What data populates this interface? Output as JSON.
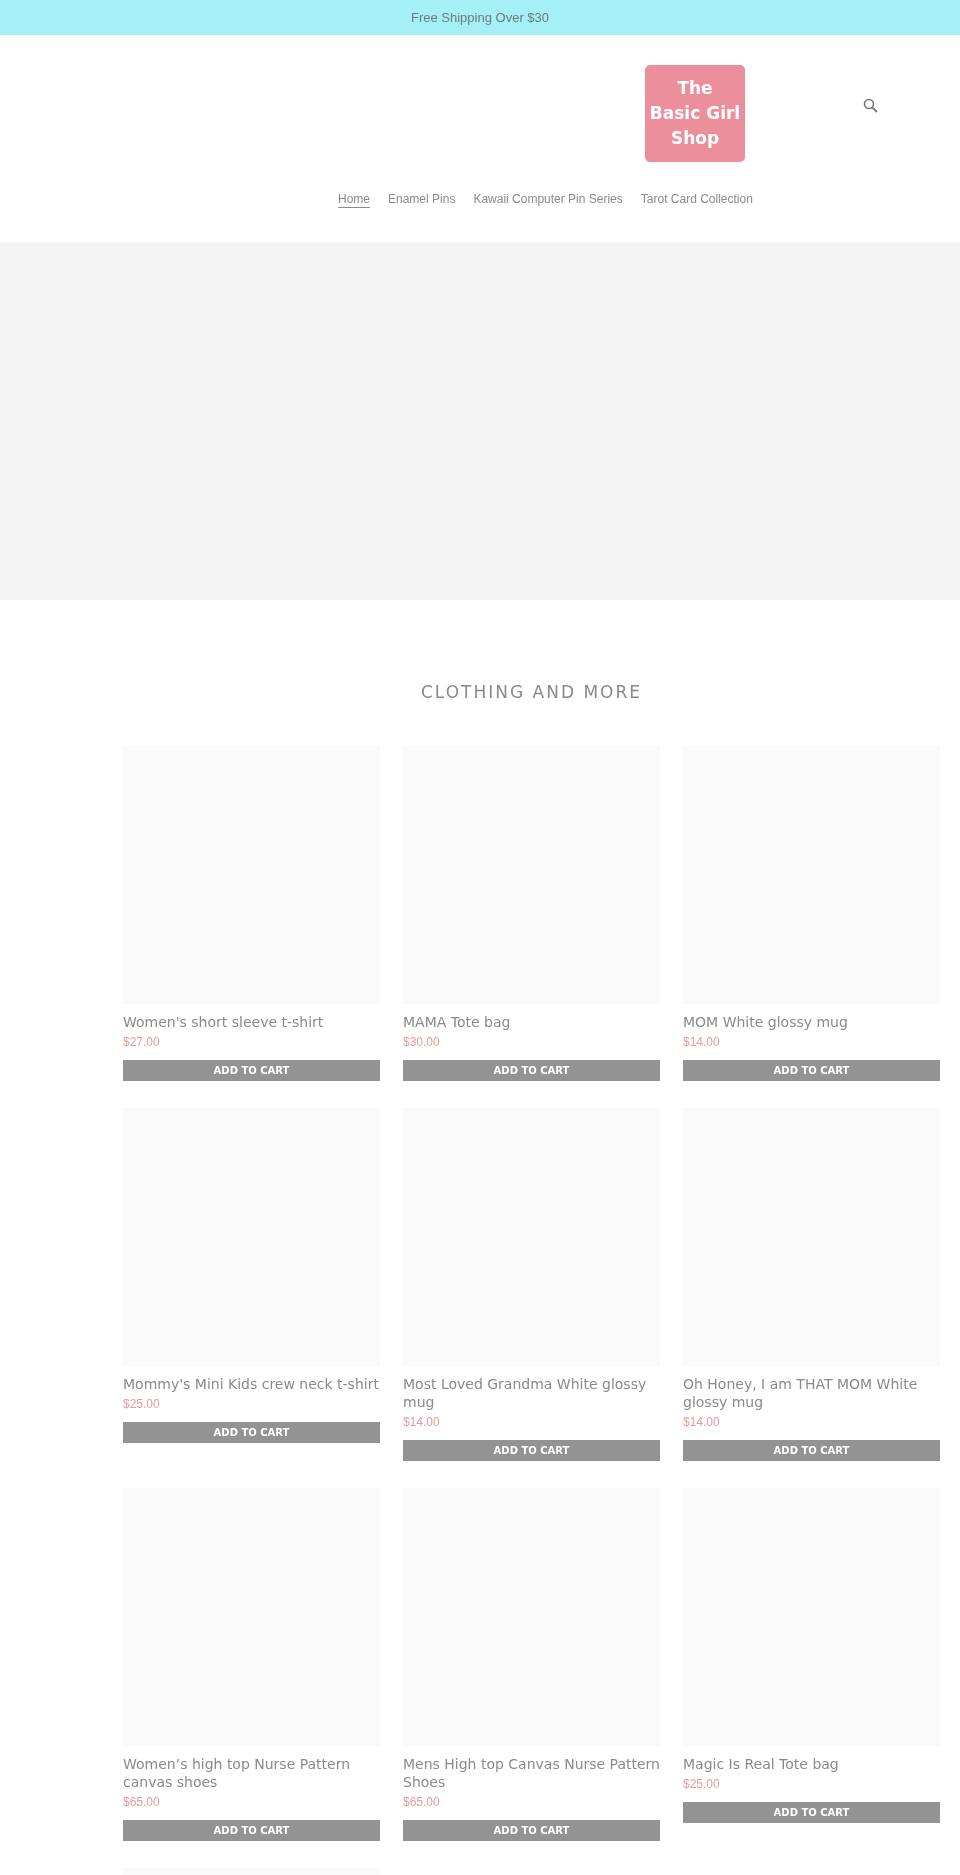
{
  "announcement": "Free Shipping Over $30",
  "logo": {
    "lines": [
      "The",
      "Basic Girl",
      "Shop"
    ]
  },
  "nav": [
    {
      "label": "Home",
      "selected": true
    },
    {
      "label": "Enamel Pins",
      "selected": false
    },
    {
      "label": "Kawaii Computer Pin Series",
      "selected": false
    },
    {
      "label": "Tarot Card Collection",
      "selected": false
    }
  ],
  "section_title": "CLOTHING AND MORE",
  "products": [
    {
      "kind": "full",
      "title": "Women's short sleeve t-shirt",
      "price": "$27.00",
      "button": "ADD TO CART"
    },
    {
      "kind": "full",
      "title": "MAMA Tote bag",
      "price": "$30.00",
      "button": "ADD TO CART"
    },
    {
      "kind": "full",
      "title": "MOM White glossy mug",
      "price": "$14.00",
      "button": "ADD TO CART"
    },
    {
      "kind": "full",
      "title": "Mommy's Mini Kids crew neck t-shirt",
      "price": "$25.00",
      "button": "ADD TO CART"
    },
    {
      "kind": "full",
      "title": "Most Loved Grandma White glossy mug",
      "price": "$14.00",
      "button": "ADD TO CART"
    },
    {
      "kind": "full",
      "title": "Oh Honey, I am THAT MOM White glossy mug",
      "price": "$14.00",
      "button": "ADD TO CART"
    },
    {
      "kind": "full",
      "title": "Women’s high top Nurse Pattern canvas shoes",
      "price": "$65.00",
      "button": "ADD TO CART"
    },
    {
      "kind": "full",
      "title": "Mens High top Canvas Nurse Pattern Shoes",
      "price": "$65.00",
      "button": "ADD TO CART"
    },
    {
      "kind": "full",
      "title": "Magic Is Real Tote bag",
      "price": "$25.00",
      "button": "ADD TO CART"
    },
    {
      "kind": "image_only"
    }
  ]
}
